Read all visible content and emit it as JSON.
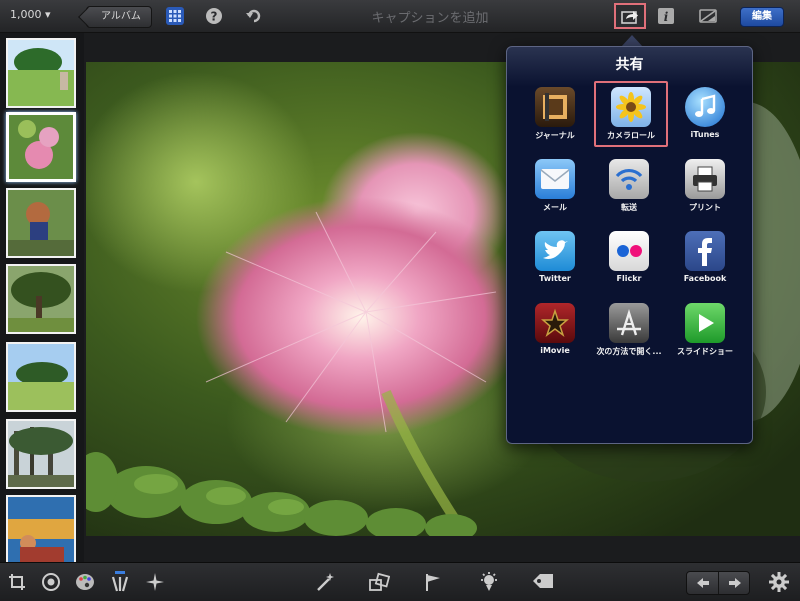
{
  "toolbar": {
    "count_label": "1,000 ▾",
    "album_button": "アルバム",
    "caption_placeholder": "キャプションを追加",
    "edit_button": "編集"
  },
  "share_popover": {
    "title": "共有",
    "items": [
      {
        "label": "ジャーナル",
        "icon": "journal-icon"
      },
      {
        "label": "カメラロール",
        "icon": "camera-roll-icon"
      },
      {
        "label": "iTunes",
        "icon": "itunes-icon"
      },
      {
        "label": "メール",
        "icon": "mail-icon"
      },
      {
        "label": "転送",
        "icon": "transfer-icon"
      },
      {
        "label": "プリント",
        "icon": "print-icon"
      },
      {
        "label": "Twitter",
        "icon": "twitter-icon"
      },
      {
        "label": "Flickr",
        "icon": "flickr-icon"
      },
      {
        "label": "Facebook",
        "icon": "facebook-icon"
      },
      {
        "label": "iMovie",
        "icon": "imovie-icon"
      },
      {
        "label": "次の方法で開く...",
        "icon": "open-in-icon"
      },
      {
        "label": "スライドショー",
        "icon": "slideshow-icon"
      }
    ]
  },
  "colors": {
    "highlight": "#e0707a",
    "accent_blue": "#2a5ab8",
    "popover_bg": "#0a1230"
  }
}
